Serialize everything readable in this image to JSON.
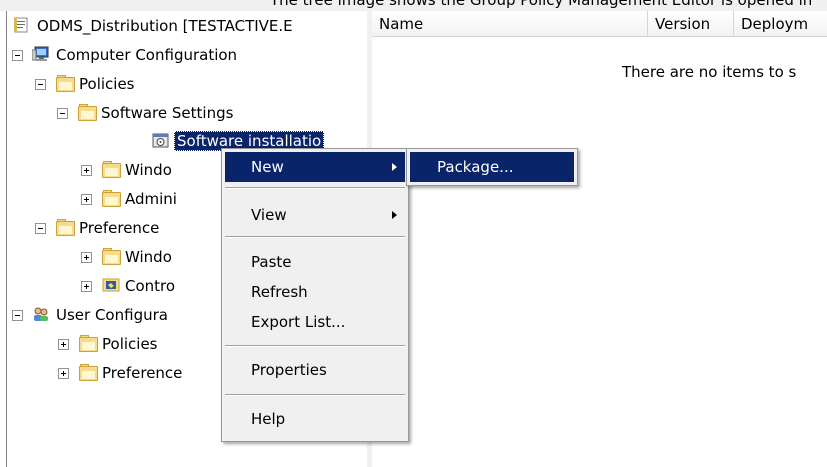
{
  "title_strip_text": "The tree image shows the Group Policy Management Editor is opened in",
  "tree": {
    "root_label": "ODMS_Distribution [TESTACTIVE.E",
    "computer_config": "Computer Configuration",
    "policies": "Policies",
    "software_settings": "Software Settings",
    "software_installation": "Software installatio",
    "windows_settings": "Windo",
    "admin_templates": "Admini",
    "preferences": "Preference",
    "pref_windows": "Windo",
    "pref_control": "Contro",
    "user_config": "User Configura",
    "user_policies": "Policies",
    "user_preferences": "Preference"
  },
  "list": {
    "columns": [
      "Name",
      "Version",
      "Deploym"
    ],
    "empty_message": "There are no items to s"
  },
  "context_menu": {
    "items": [
      "New",
      "View",
      "Paste",
      "Refresh",
      "Export List...",
      "Properties",
      "Help"
    ]
  },
  "submenu": {
    "items": [
      "Package..."
    ]
  },
  "colors": {
    "highlight": "#0a246a",
    "menu_bg": "#f0f0f0"
  }
}
